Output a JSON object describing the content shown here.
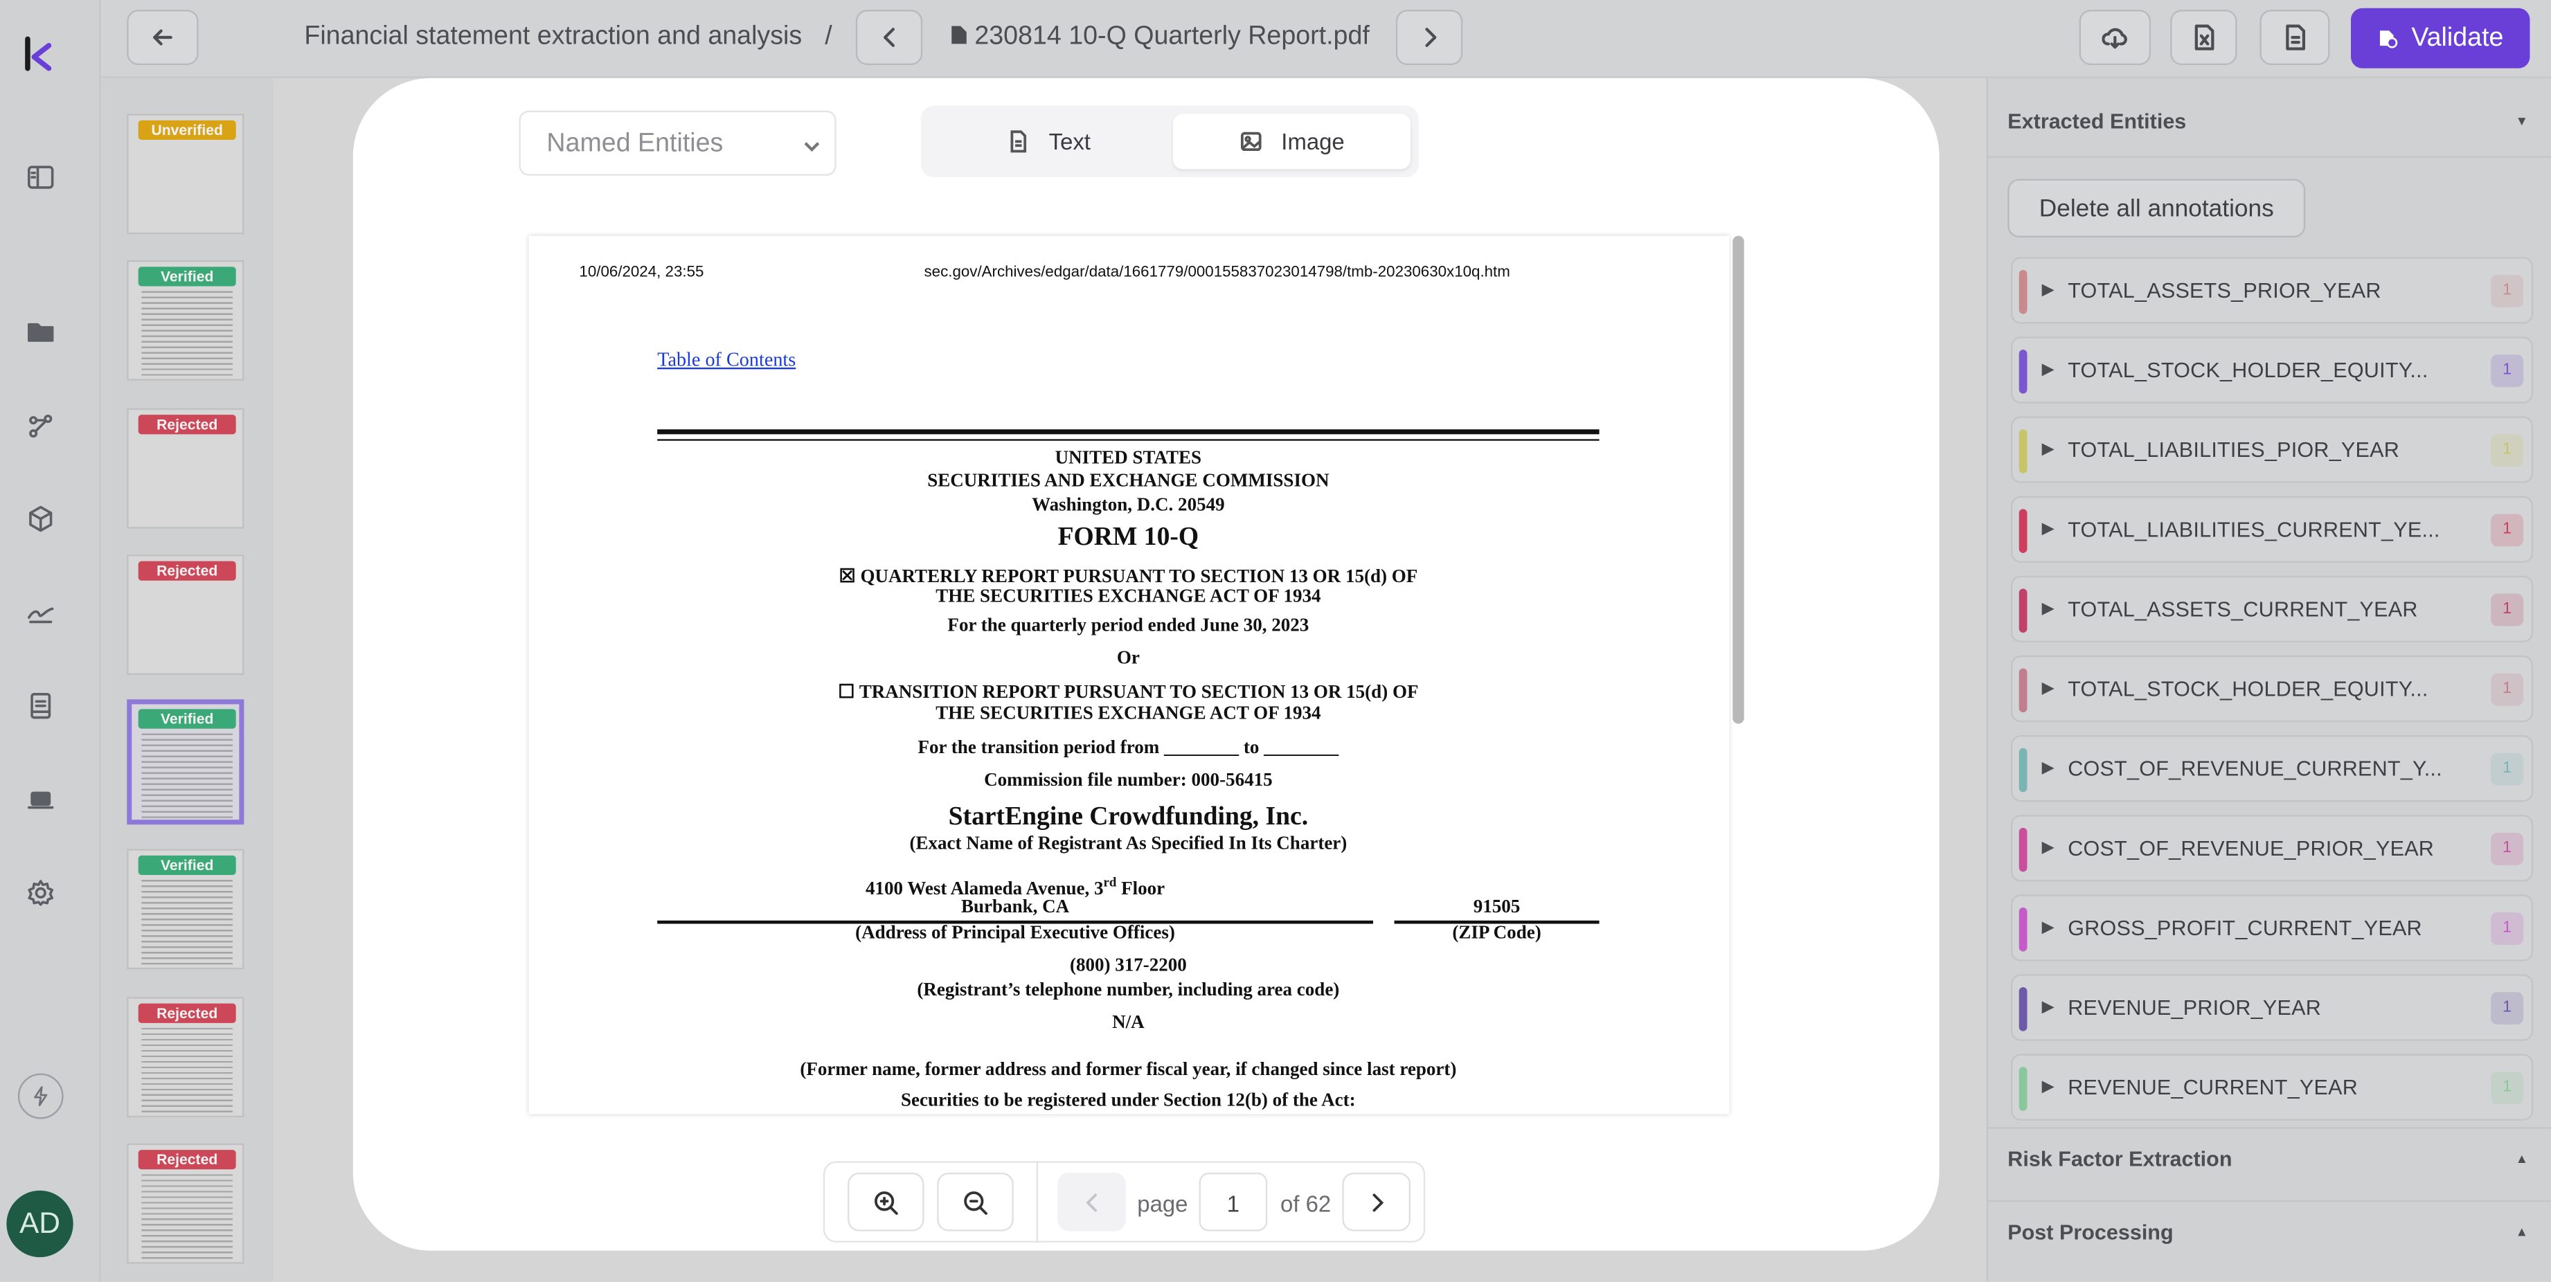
{
  "topbar": {
    "breadcrumb_project": "Financial statement extraction and analysis",
    "breadcrumb_separator": "/",
    "document_name": "230814 10-Q Quarterly Report.pdf",
    "validate_label": "Validate",
    "accent_color": "#6a3fd8"
  },
  "user": {
    "initials": "AD"
  },
  "thumbnails": [
    {
      "status": "Unverified",
      "selected": false
    },
    {
      "status": "Verified",
      "selected": false
    },
    {
      "status": "Rejected",
      "selected": false
    },
    {
      "status": "Rejected",
      "selected": false
    },
    {
      "status": "Verified",
      "selected": true
    },
    {
      "status": "Verified",
      "selected": false
    },
    {
      "status": "Rejected",
      "selected": false
    },
    {
      "status": "Rejected",
      "selected": false
    }
  ],
  "viewer": {
    "view_select": "Named Entities",
    "tab_text": "Text",
    "tab_image": "Image",
    "active_tab": "Image",
    "pager": {
      "page_label": "page",
      "current_page": "1",
      "total_label": "of 62"
    }
  },
  "document": {
    "header_date": "10/06/2024, 23:55",
    "header_url": "sec.gov/Archives/edgar/data/1661779/000155837023014798/tmb-20230630x10q.htm",
    "toc_link": "Table of Contents",
    "line_country": "UNITED STATES",
    "line_commission": "SECURITIES AND EXCHANGE COMMISSION",
    "line_city": "Washington, D.C. 20549",
    "form": "FORM 10-Q",
    "quarterly_1": "☒ QUARTERLY REPORT PURSUANT TO SECTION 13 OR 15(d) OF",
    "quarterly_2": "THE SECURITIES EXCHANGE ACT OF 1934",
    "period": "For the quarterly period ended June 30, 2023",
    "or": "Or",
    "transition_1": "☐ TRANSITION REPORT PURSUANT TO SECTION 13 OR 15(d) OF",
    "transition_2": "THE SECURITIES EXCHANGE ACT OF 1934",
    "transition_period": "For the transition period from ________ to ________",
    "commission_file": "Commission file number: 000-56415",
    "company": "StartEngine Crowdfunding, Inc.",
    "company_sub": "(Exact Name of Registrant As Specified In Its Charter)",
    "address_1a": "4100 West Alameda Avenue, 3",
    "address_1_sup": "rd",
    "address_1b": " Floor",
    "address_2": "Burbank, CA",
    "zip": "91505",
    "address_caption": "(Address of Principal Executive Offices)",
    "zip_caption": "(ZIP Code)",
    "phone": "(800) 317-2200",
    "phone_caption": "(Registrant’s telephone number, including area code)",
    "na": "N/A",
    "former_name": "(Former name, former address and former fiscal year, if changed since last report)",
    "section_12b": "Securities to be registered under Section 12(b) of the Act:"
  },
  "right_panel": {
    "section_extracted": "Extracted Entities",
    "delete_all": "Delete all annotations",
    "entities": [
      {
        "name": "TOTAL_ASSETS_PRIOR_YEAR",
        "count": "1",
        "color": "#c98a8e"
      },
      {
        "name": "TOTAL_STOCK_HOLDER_EQUITY...",
        "count": "1",
        "color": "#7b57cf"
      },
      {
        "name": "TOTAL_LIABILITIES_PIOR_YEAR",
        "count": "1",
        "color": "#c8c46a"
      },
      {
        "name": "TOTAL_LIABILITIES_CURRENT_YE...",
        "count": "1",
        "color": "#cd3f5e"
      },
      {
        "name": "TOTAL_ASSETS_CURRENT_YEAR",
        "count": "1",
        "color": "#c0416a"
      },
      {
        "name": "TOTAL_STOCK_HOLDER_EQUITY...",
        "count": "1",
        "color": "#c17e8e"
      },
      {
        "name": "COST_OF_REVENUE_CURRENT_Y...",
        "count": "1",
        "color": "#7bb5b3"
      },
      {
        "name": "COST_OF_REVENUE_PRIOR_YEAR",
        "count": "1",
        "color": "#c94f9d"
      },
      {
        "name": "GROSS_PROFIT_CURRENT_YEAR",
        "count": "1",
        "color": "#c45bc9"
      },
      {
        "name": "REVENUE_PRIOR_YEAR",
        "count": "1",
        "color": "#6d5aa9"
      },
      {
        "name": "REVENUE_CURRENT_YEAR",
        "count": "1",
        "color": "#8cc79c"
      }
    ],
    "section_risk": "Risk Factor Extraction",
    "section_post": "Post Processing"
  }
}
